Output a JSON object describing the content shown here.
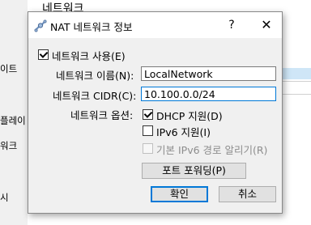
{
  "background": {
    "header": "네트워크",
    "left_items": [
      "이트",
      "플레이",
      "워크",
      "시"
    ]
  },
  "dialog": {
    "title": "NAT 네트워크 정보",
    "help_label": "?",
    "close_label": "✕",
    "enable_label": "네트워크 사용(E)",
    "enable_checked": true,
    "name_label": "네트워크 이름(N):",
    "name_value": "LocalNetwork",
    "cidr_label": "네트워크 CIDR(C):",
    "cidr_value": "10.100.0.0/24",
    "options_label": "네트워크 옵션:",
    "options": {
      "dhcp_label": "DHCP 지원(D)",
      "dhcp_checked": true,
      "ipv6_label": "IPv6 지원(I)",
      "ipv6_checked": false,
      "ipv6_route_label": "기본 IPv6 경로 알리기(R)",
      "ipv6_route_checked": false,
      "ipv6_route_enabled": false
    },
    "port_forwarding_label": "포트 포워딩(P)",
    "ok_label": "확인",
    "cancel_label": "취소"
  },
  "colors": {
    "accent": "#0078d7",
    "dialog_bg": "#f0f0f0",
    "selection_bg": "#cfe6f7"
  }
}
